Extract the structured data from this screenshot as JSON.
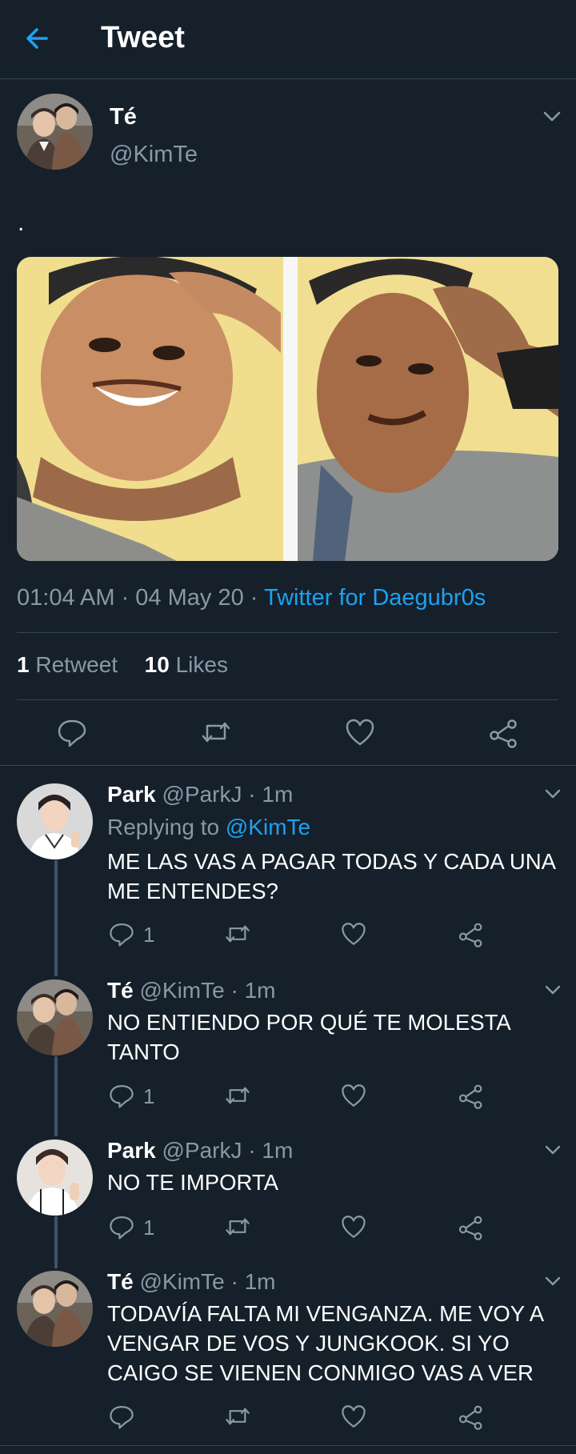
{
  "header": {
    "title": "Tweet"
  },
  "main_tweet": {
    "name": "Té",
    "handle": "@KimTe",
    "text": ".",
    "time": "01:04 AM · 04 May 20 ·",
    "source": "Twitter for Daegubr0s",
    "retweets_count": "1",
    "retweets_label": "Retweet",
    "likes_count": "10",
    "likes_label": "Likes"
  },
  "replies": [
    {
      "name": "Park",
      "handle_time": "@ParkJ · 1m",
      "replying_prefix": "Replying to",
      "replying_to": "@KimTe",
      "text": "ME LAS VAS A PAGAR TODAS Y CADA UNA ME ENTENDES?",
      "reply_count": "1"
    },
    {
      "name": "Té",
      "handle_time": "@KimTe · 1m",
      "text": "NO ENTIENDO POR QUÉ TE MOLESTA TANTO",
      "reply_count": "1"
    },
    {
      "name": "Park",
      "handle_time": "@ParkJ · 1m",
      "text": "NO TE IMPORTA",
      "reply_count": "1"
    },
    {
      "name": "Té",
      "handle_time": "@KimTe · 1m",
      "text": "TODAVÍA FALTA MI VENGANZA. ME VOY A VENGAR DE VOS Y JUNGKOOK. SI YO CAIGO SE VIENEN CONMIGO VAS A VER",
      "reply_count": ""
    }
  ],
  "colors": {
    "background": "#15202b",
    "divider": "#38444d",
    "muted": "#8899a6",
    "accent": "#1da1f2"
  },
  "icons": [
    "back-arrow-icon",
    "chevron-down-icon",
    "reply-icon",
    "retweet-icon",
    "like-icon",
    "share-icon"
  ]
}
